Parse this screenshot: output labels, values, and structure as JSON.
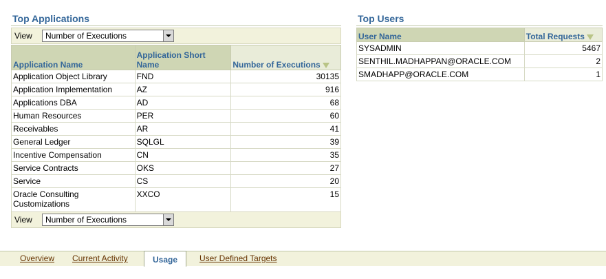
{
  "top_apps": {
    "title": "Top Applications",
    "view_label": "View",
    "view_value": "Number of Executions",
    "columns": [
      "Application Name",
      "Application Short Name",
      "Number of Executions"
    ],
    "rows": [
      [
        "Application Object Library",
        "FND",
        "30135"
      ],
      [
        "Application Implementation",
        "AZ",
        "916"
      ],
      [
        "Applications DBA",
        "AD",
        "68"
      ],
      [
        "Human Resources",
        "PER",
        "60"
      ],
      [
        "Receivables",
        "AR",
        "41"
      ],
      [
        "General Ledger",
        "SQLGL",
        "39"
      ],
      [
        "Incentive Compensation",
        "CN",
        "35"
      ],
      [
        "Service Contracts",
        "OKS",
        "27"
      ],
      [
        "Service",
        "CS",
        "20"
      ],
      [
        "Oracle Consulting Customizations",
        "XXCO",
        "15"
      ]
    ]
  },
  "top_users": {
    "title": "Top Users",
    "columns": [
      "User Name",
      "Total Requests"
    ],
    "rows": [
      [
        "SYSADMIN",
        "5467"
      ],
      [
        "SENTHIL.MADHAPPAN@ORACLE.COM",
        "2"
      ],
      [
        "SMADHAPP@ORACLE.COM",
        "1"
      ]
    ]
  },
  "tabs": [
    "Overview",
    "Current Activity",
    "Usage",
    "User Defined Targets"
  ],
  "selected_tab": "Usage"
}
